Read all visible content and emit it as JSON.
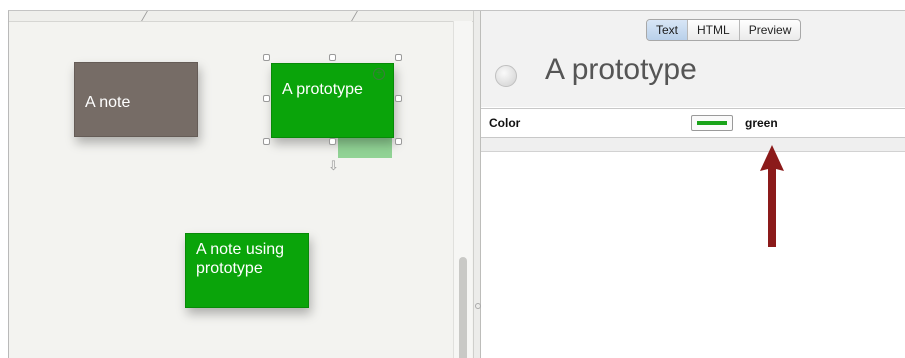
{
  "map": {
    "notes": {
      "gray": "A note",
      "prototype": "A prototype",
      "using": "A note using prototype"
    }
  },
  "inspector": {
    "tabs": [
      "Text",
      "HTML",
      "Preview"
    ],
    "active_tab": "Text",
    "note_title": "A prototype",
    "attribute": {
      "name": "Color",
      "value": "green"
    }
  },
  "colors": {
    "gray_note": "#766c66",
    "green_note": "#0aa40a",
    "annotation_arrow": "#8b1a1a"
  }
}
